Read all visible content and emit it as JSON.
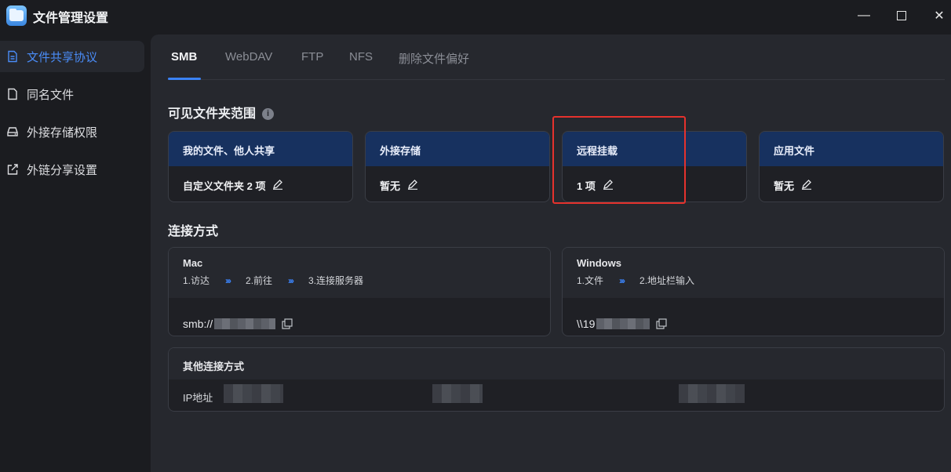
{
  "window": {
    "title": "文件管理设置",
    "minimize_glyph": "—",
    "close_glyph": "✕"
  },
  "sidebar": {
    "items": [
      {
        "label": "文件共享协议",
        "icon": "document-icon",
        "active": true
      },
      {
        "label": "同名文件",
        "icon": "file-icon",
        "active": false
      },
      {
        "label": "外接存储权限",
        "icon": "drive-icon",
        "active": false
      },
      {
        "label": "外链分享设置",
        "icon": "share-link-icon",
        "active": false
      }
    ]
  },
  "tabs": [
    {
      "label": "SMB",
      "active": true
    },
    {
      "label": "WebDAV",
      "active": false
    },
    {
      "label": "FTP",
      "active": false
    },
    {
      "label": "NFS",
      "active": false
    },
    {
      "label": "删除文件偏好",
      "active": false
    }
  ],
  "scope": {
    "title": "可见文件夹范围",
    "info_glyph": "i",
    "cards": [
      {
        "title": "我的文件、他人共享",
        "value": "自定义文件夹 2 项"
      },
      {
        "title": "外接存储",
        "value": "暂无"
      },
      {
        "title": "远程挂载",
        "value": "1 项"
      },
      {
        "title": "应用文件",
        "value": "暂无"
      }
    ]
  },
  "connection": {
    "title": "连接方式",
    "mac": {
      "name": "Mac",
      "steps": [
        "1.访达",
        "2.前往",
        "3.连接服务器"
      ],
      "arrow": "›››",
      "address_prefix": "smb://"
    },
    "windows": {
      "name": "Windows",
      "steps": [
        "1.文件",
        "2.地址栏输入"
      ],
      "arrow": "›››",
      "address_prefix": "\\\\19"
    },
    "other": {
      "title": "其他连接方式",
      "ip_label": "IP地址"
    }
  },
  "colors": {
    "accent": "#3b82f6",
    "card_header": "#17315f",
    "highlight_box": "#e5322d"
  }
}
